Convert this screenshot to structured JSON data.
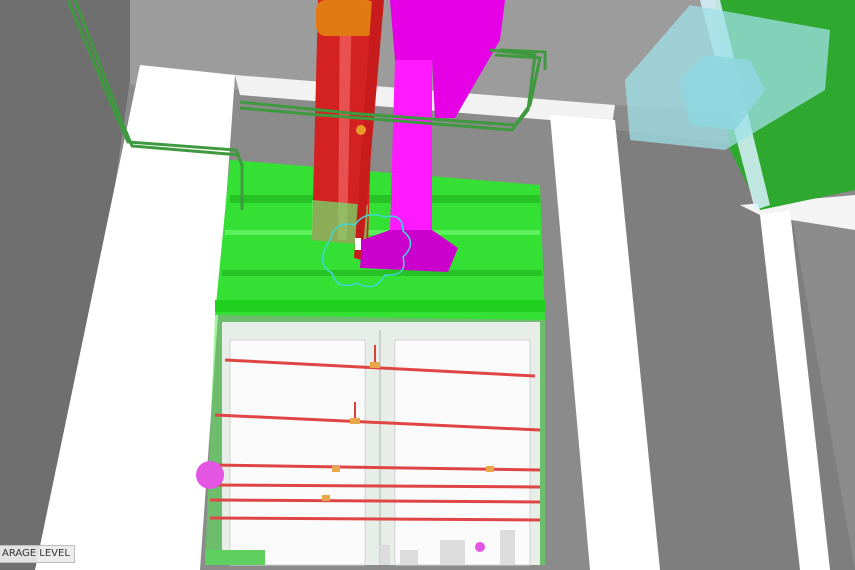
{
  "viewport": {
    "level_label": "ARAGE LEVEL"
  },
  "colors": {
    "background": "#8d8d8d",
    "wall_white": "#ffffff",
    "green_volume": "#33e033",
    "magenta_duct": "#ff00ff",
    "red_pipe": "#d62020",
    "orange_pipe": "#e07a10",
    "green_pipe": "#4bb04b",
    "translucent_box": "#9fe0e8",
    "sprinkler_line": "#e04040"
  }
}
